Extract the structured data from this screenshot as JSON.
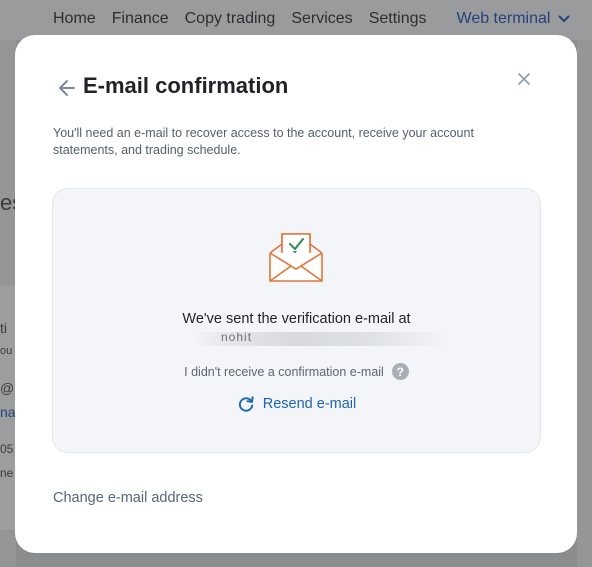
{
  "nav": {
    "items": [
      "Home",
      "Finance",
      "Copy trading",
      "Services",
      "Settings"
    ],
    "web_terminal": "Web terminal"
  },
  "background": {
    "fragments": [
      "es",
      "ti",
      "ou",
      "@",
      "nai",
      "05",
      "ne"
    ]
  },
  "modal": {
    "title": "E-mail confirmation",
    "description": "You'll need an e-mail to recover access to the account, receive your account statements, and trading schedule.",
    "sent_text": "We've sent the verification e-mail at",
    "email_visible": "nohit",
    "no_receive_text": "I didn't receive a confirmation e-mail",
    "help_glyph": "?",
    "resend_label": "Resend e-mail",
    "change_email_label": "Change e-mail address"
  },
  "icons": {
    "back": "arrow-left-icon",
    "close": "close-icon",
    "envelope": "envelope-check-icon",
    "help": "question-circle-icon",
    "resend": "refresh-icon",
    "dropdown": "chevron-down-icon"
  },
  "colors": {
    "accent": "#1e64b4",
    "envelope": "#e0773a",
    "check": "#2e8b57",
    "nav_active": "#25427c"
  }
}
